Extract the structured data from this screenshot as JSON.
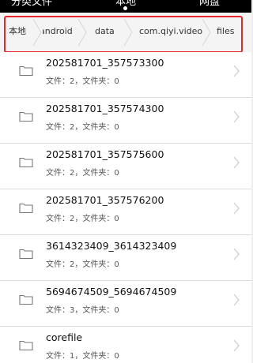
{
  "tabs": {
    "left": "分类文件",
    "center": "本地",
    "right": "网盘"
  },
  "breadcrumb": [
    "本地",
    "android",
    "data",
    "com.qiyi.video",
    "files"
  ],
  "files": [
    {
      "name": "202581701_357573300",
      "meta": "文件：2，文件夹：0"
    },
    {
      "name": "202581701_357574300",
      "meta": "文件：2，文件夹：0"
    },
    {
      "name": "202581701_357575600",
      "meta": "文件：2，文件夹：0"
    },
    {
      "name": "202581701_357576200",
      "meta": "文件：2，文件夹：0"
    },
    {
      "name": "3614323409_3614323409",
      "meta": "文件：2，文件夹：0"
    },
    {
      "name": "5694674509_5694674509",
      "meta": "文件：3，文件夹：0"
    },
    {
      "name": "corefile",
      "meta": "文件：1，文件夹：0"
    }
  ],
  "colors": {
    "highlight": "#e8262c",
    "topbar": "#000000"
  },
  "icons": {
    "folder": "folder-icon",
    "chevron": "chevron-right-icon",
    "separator": "breadcrumb-separator-icon"
  }
}
